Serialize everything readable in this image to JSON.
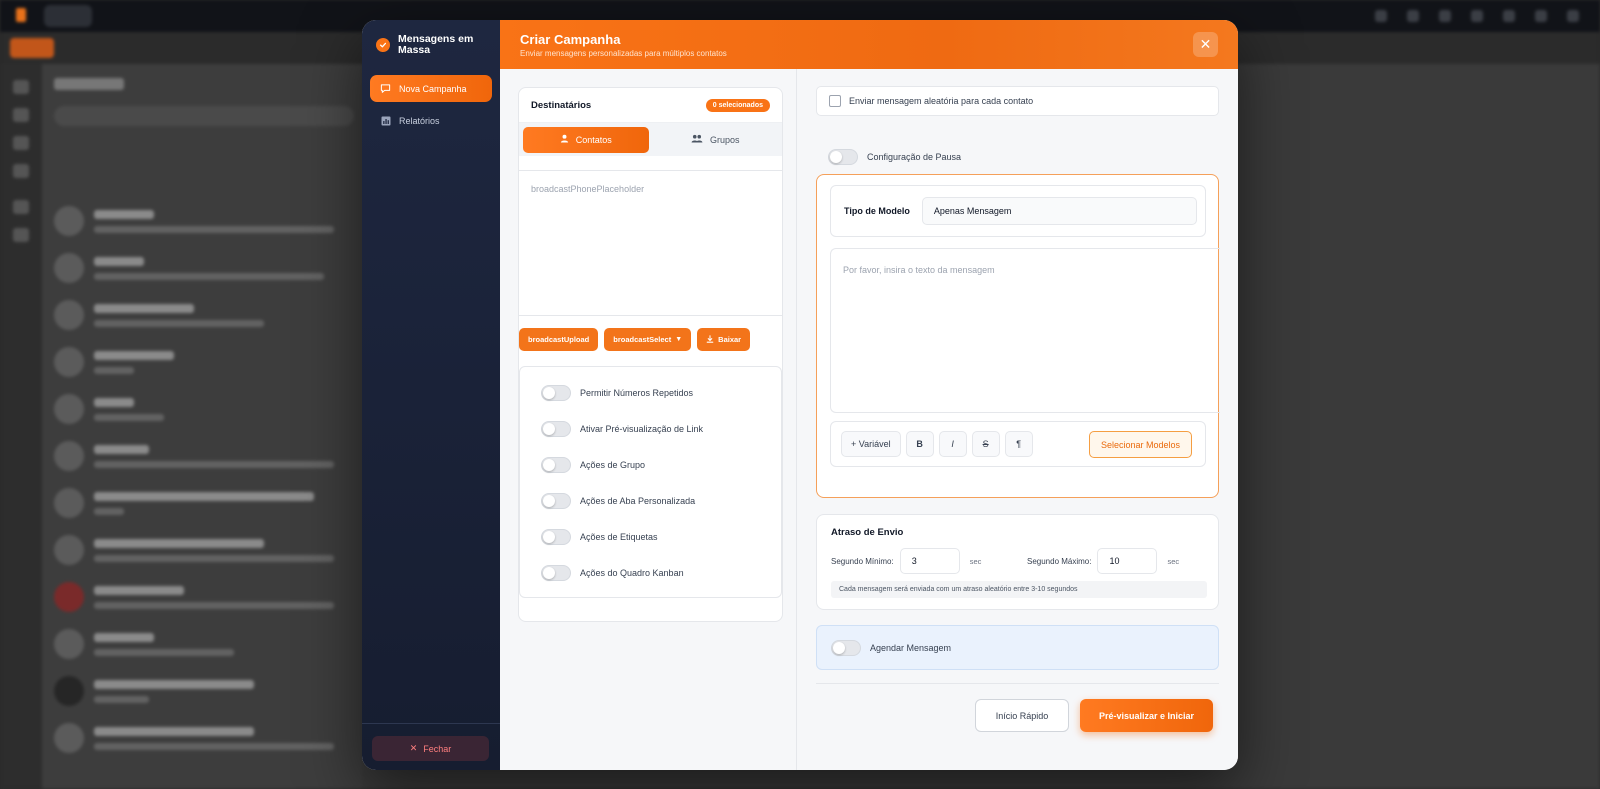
{
  "sidebar": {
    "brand_title": "Mensagens em Massa",
    "items": [
      {
        "label": "Nova Campanha",
        "icon": "message-icon",
        "active": true
      },
      {
        "label": "Relatórios",
        "icon": "chart-icon",
        "active": false
      }
    ],
    "close_label": "Fechar"
  },
  "header": {
    "title": "Criar Campanha",
    "subtitle": "Enviar mensagens personalizadas para múltiplos contatos",
    "close_icon": "close-icon"
  },
  "recipients": {
    "title": "Destinatários",
    "badge": "0 selecionados",
    "tabs": [
      {
        "label": "Contatos",
        "icon": "person-icon",
        "active": true
      },
      {
        "label": "Grupos",
        "icon": "group-icon",
        "active": false
      }
    ],
    "phone_placeholder": "broadcastPhonePlaceholder",
    "buttons": {
      "upload": "broadcastUpload",
      "select": "broadcastSelect",
      "download": "Baixar"
    },
    "toggles": [
      {
        "label": "Permitir Números Repetidos",
        "on": false
      },
      {
        "label": "Ativar Pré-visualização de Link",
        "on": false
      },
      {
        "label": "Ações de Grupo",
        "on": false
      },
      {
        "label": "Ações de Aba Personalizada",
        "on": false
      },
      {
        "label": "Ações de Etiquetas",
        "on": false
      },
      {
        "label": "Ações do Quadro Kanban",
        "on": false
      }
    ]
  },
  "options": {
    "random_message_label": "Enviar mensagem aleatória para cada contato",
    "random_message_checked": false,
    "pause_config_label": "Configuração de Pausa",
    "pause_config_on": false
  },
  "template": {
    "type_label": "Tipo de Modelo",
    "type_value": "Apenas Mensagem",
    "message_placeholder": "Por favor, insira o texto da mensagem",
    "toolbar": {
      "variable": "+ Variável",
      "bold": "B",
      "italic": "I",
      "strike": "S",
      "paragraph": "¶",
      "select_models": "Selecionar Modelos"
    }
  },
  "delay": {
    "title": "Atraso de Envio",
    "min_label": "Segundo Mínimo:",
    "min_value": "3",
    "max_label": "Segundo Máximo:",
    "max_value": "10",
    "unit": "sec",
    "note": "Cada mensagem será enviada com um atraso aleatório entre 3-10 segundos"
  },
  "schedule": {
    "label": "Agendar Mensagem",
    "on": false
  },
  "actions": {
    "quick_start": "Início Rápido",
    "preview_start": "Pré-visualizar e Iniciar"
  },
  "colors": {
    "accent": "#f97316",
    "sidebar_bg": "#1e2740",
    "schedule_bg": "#eaf2fd"
  }
}
